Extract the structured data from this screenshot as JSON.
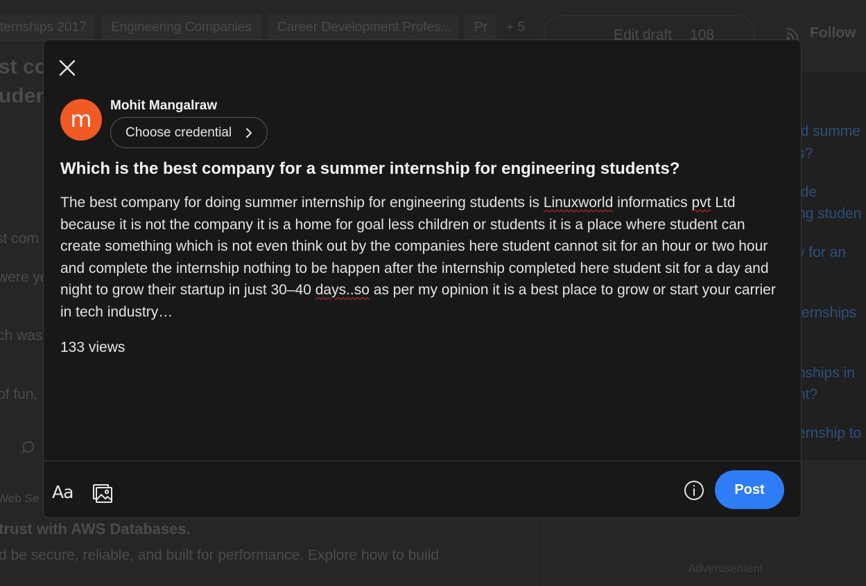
{
  "background": {
    "topics": [
      "ternships 2017",
      "Engineering Companies",
      "Career Development Profes...",
      "Pr",
      "+ 5"
    ],
    "edit_draft_label": "Edit draft",
    "edit_draft_count": "108",
    "follow_label": "Follow",
    "left_fragments": [
      "st co",
      "uden",
      "st com",
      "were yo",
      "ch was",
      "of fun,",
      "Web Se",
      "trust with AWS Databases.",
      "d be secure, reliable, and built for performance. Explore how to build"
    ],
    "right_links": [
      "id summe",
      "s?",
      "ide",
      "ng studen",
      "y for an",
      "ternships",
      "nships in",
      "nt?",
      "ernship to"
    ],
    "advertisement_label": "Advertisement"
  },
  "modal": {
    "author_name": "Mohit Mangalraw",
    "avatar_letter": "m",
    "credential_label": "Choose credential",
    "question_title": "Which is the best company for a summer internship for engineering students?",
    "answer": {
      "p1": "The best company for doing summer internship for engineering students is ",
      "w1": "Linuxworld",
      "p2": " informatics ",
      "w2": "pvt",
      "p3": " Ltd because it is not the company it is a home for goal less children or students it is a place where student can create something which is not even think out by the companies here student cannot sit for an hour or two hour and complete the internship nothing to be happen after the internship completed here student sit for a day and night to grow their startup in just 30–40 ",
      "w3": "days..so",
      "p4": " as per my opinion it is a best place to grow or start your carrier in tech industry…"
    },
    "views": "133 views",
    "footer": {
      "format_label": "Aa",
      "post_label": "Post"
    }
  },
  "colors": {
    "accent": "#2e7cf6",
    "avatar": "#f15a24",
    "modal_bg": "#181818",
    "spellcheck": "#e02b2b"
  }
}
